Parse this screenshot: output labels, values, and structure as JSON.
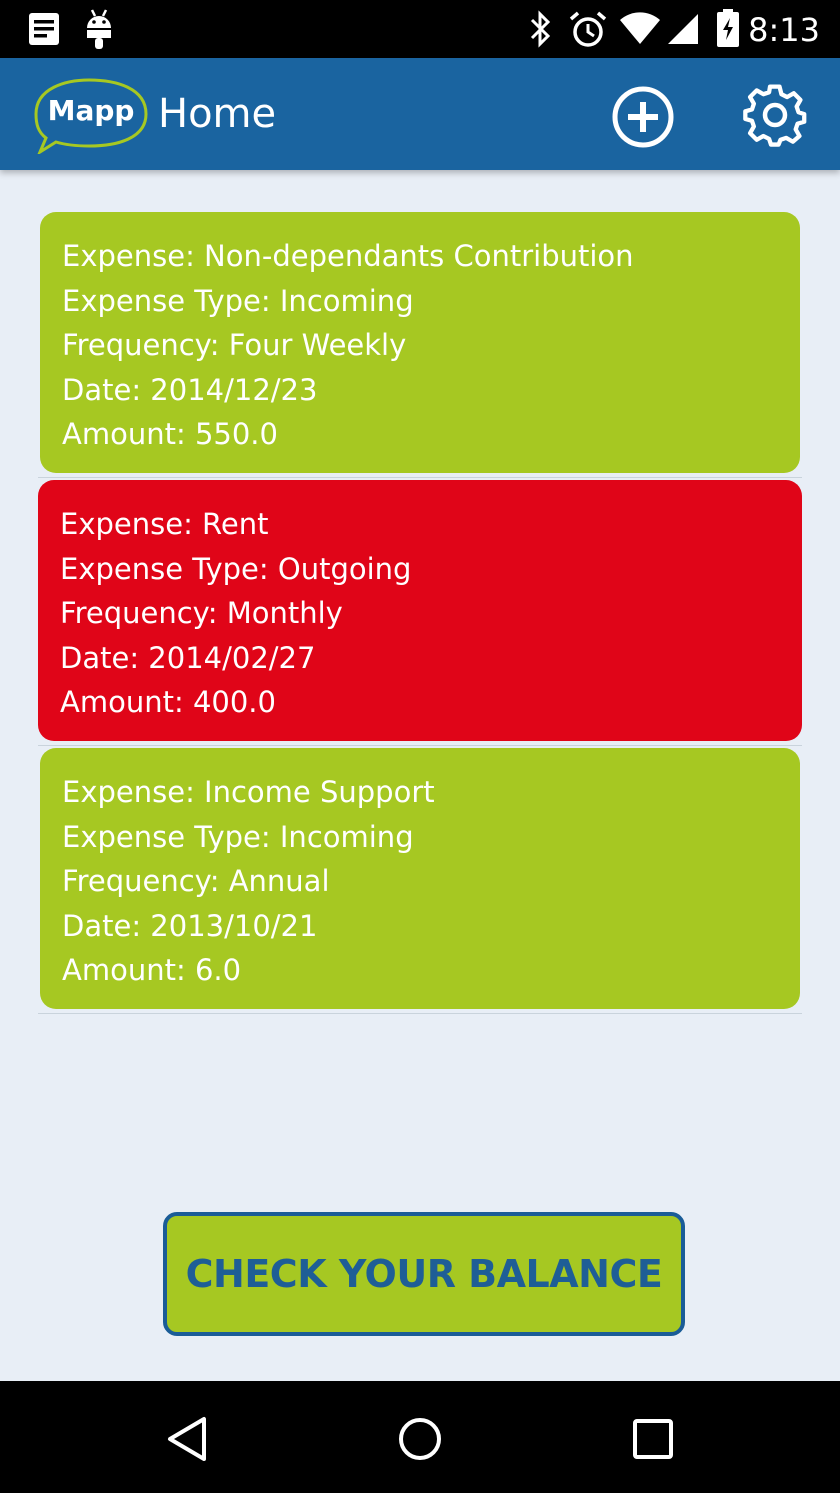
{
  "status_bar": {
    "time": "8:13",
    "icons_left": [
      "notes-icon",
      "android-icon"
    ],
    "icons_right": [
      "bluetooth-icon",
      "alarm-icon",
      "wifi-icon",
      "signal-icon",
      "battery-charging-icon"
    ]
  },
  "app_bar": {
    "logo_text": "Mapp",
    "title": "Home",
    "add_icon": "add-circle-icon",
    "settings_icon": "gear-icon"
  },
  "expenses": [
    {
      "expense": "Expense: Non-dependants Contribution",
      "type": "Expense Type: Incoming",
      "frequency": "Frequency: Four Weekly",
      "date": "Date: 2014/12/23",
      "amount": "Amount: 550.0",
      "color": "#a6c822"
    },
    {
      "expense": "Expense: Rent",
      "type": "Expense Type: Outgoing",
      "frequency": "Frequency: Monthly",
      "date": "Date: 2014/02/27",
      "amount": "Amount: 400.0",
      "color": "#e00518"
    },
    {
      "expense": "Expense: Income Support",
      "type": "Expense Type: Incoming",
      "frequency": "Frequency: Annual",
      "date": "Date: 2013/10/21",
      "amount": "Amount: 6.0",
      "color": "#a6c822"
    }
  ],
  "balance_button": {
    "label": "CHECK YOUR BALANCE"
  },
  "nav_bar": {
    "back_icon": "back-icon",
    "home_icon": "home-icon",
    "recents_icon": "recents-icon"
  },
  "colors": {
    "app_bar": "#1a64a0",
    "background": "#e8eef6",
    "incoming": "#a6c822",
    "outgoing": "#e00518",
    "button_border": "#1a5c97"
  }
}
